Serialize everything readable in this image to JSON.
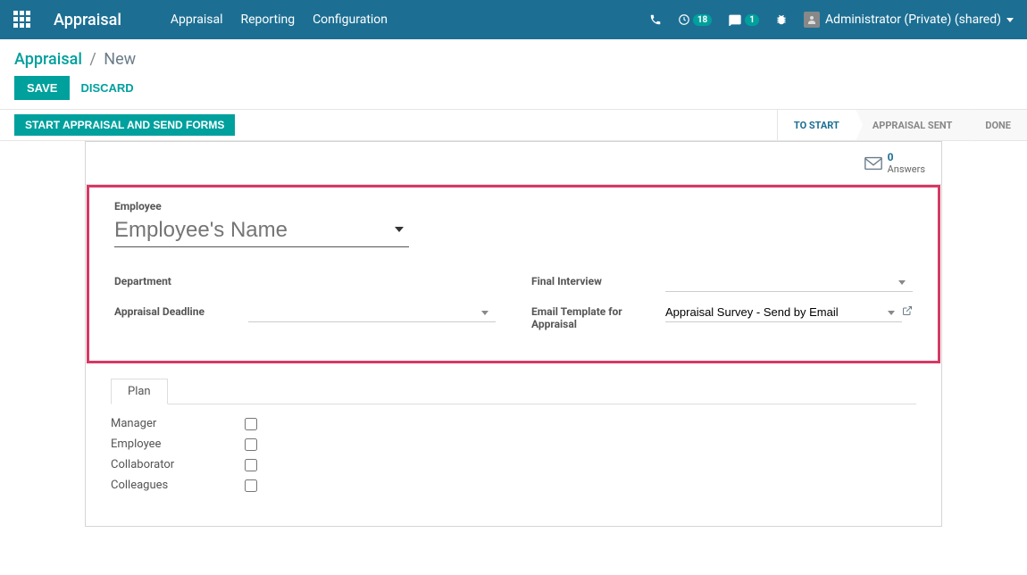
{
  "topbar": {
    "app_title": "Appraisal",
    "nav": [
      "Appraisal",
      "Reporting",
      "Configuration"
    ],
    "badge_activities": "18",
    "badge_messages": "1",
    "user_label": "Administrator (Private) (shared)"
  },
  "breadcrumb": {
    "root": "Appraisal",
    "current": "New"
  },
  "actions": {
    "save": "SAVE",
    "discard": "DISCARD",
    "start": "START APPRAISAL AND SEND FORMS"
  },
  "statusbar": {
    "steps": [
      "TO START",
      "APPRAISAL SENT",
      "DONE"
    ]
  },
  "answers": {
    "count": "0",
    "label": "Answers"
  },
  "form": {
    "employee_label": "Employee",
    "employee_placeholder": "Employee's Name",
    "left": {
      "department_label": "Department",
      "department_value": "",
      "deadline_label": "Appraisal Deadline",
      "deadline_value": ""
    },
    "right": {
      "final_interview_label": "Final Interview",
      "final_interview_value": "",
      "email_template_label": "Email Template for Appraisal",
      "email_template_value": "Appraisal Survey - Send by Email"
    }
  },
  "tabs": {
    "plan": "Plan"
  },
  "plan": {
    "rows": [
      {
        "label": "Manager",
        "checked": false
      },
      {
        "label": "Employee",
        "checked": false
      },
      {
        "label": "Collaborator",
        "checked": false
      },
      {
        "label": "Colleagues",
        "checked": false
      }
    ]
  }
}
